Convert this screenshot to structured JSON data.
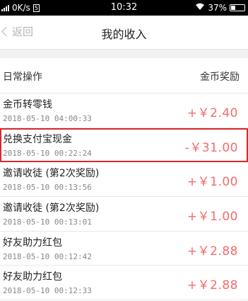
{
  "status_bar": {
    "network": "0K/s",
    "time": "10:32",
    "battery": "37%"
  },
  "nav": {
    "back_label": "返回",
    "title": "我的收入"
  },
  "list": {
    "header_left": "日常操作",
    "header_right": "金币奖励",
    "items": [
      {
        "title": "金币转零钱",
        "time": "2018-05-10 04:00:33",
        "amount": "+￥2.40",
        "highlighted": false
      },
      {
        "title": "兑换支付宝现金",
        "time": "2018-05-10 00:22:24",
        "amount": "-￥31.00",
        "highlighted": true
      },
      {
        "title": "邀请收徒 (第2次奖励)",
        "time": "2018-05-10 00:13:56",
        "amount": "+￥1.00",
        "highlighted": false
      },
      {
        "title": "邀请收徒 (第2次奖励)",
        "time": "2018-05-10 00:13:01",
        "amount": "+￥1.00",
        "highlighted": false
      },
      {
        "title": "好友助力红包",
        "time": "2018-05-10 00:12:42",
        "amount": "+￥2.88",
        "highlighted": false
      },
      {
        "title": "好友助力红包",
        "time": "2018-05-10 00:12:33",
        "amount": "+￥2.88",
        "highlighted": false
      }
    ]
  },
  "colors": {
    "amount": "#f26b6b",
    "highlight_border": "#d9282f"
  }
}
